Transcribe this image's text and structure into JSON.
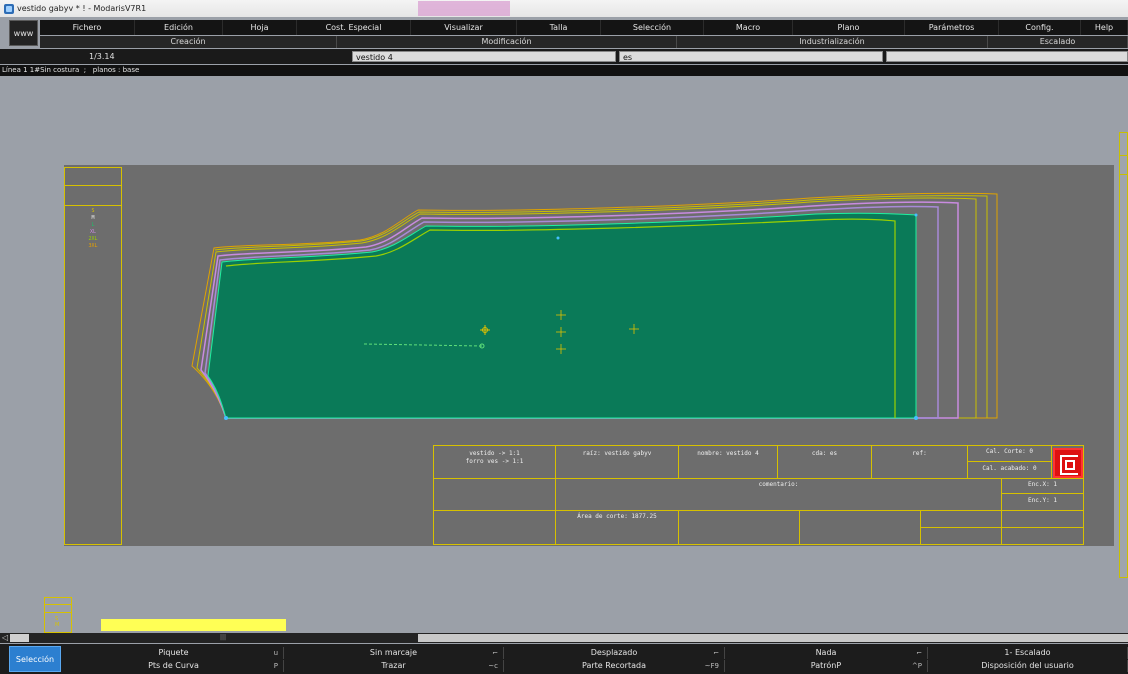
{
  "window": {
    "title": "vestido gabyv * ! - ModarisV7R1"
  },
  "www_button": "www",
  "menu": [
    {
      "label": "Fichero",
      "w": 95
    },
    {
      "label": "Edición",
      "w": 88
    },
    {
      "label": "Hoja",
      "w": 74
    },
    {
      "label": "Cost. Especial",
      "w": 114
    },
    {
      "label": "Visualizar",
      "w": 106
    },
    {
      "label": "Talla",
      "w": 84
    },
    {
      "label": "Selección",
      "w": 103
    },
    {
      "label": "Macro",
      "w": 89
    },
    {
      "label": "Plano",
      "w": 112
    },
    {
      "label": "Parámetros",
      "w": 94
    },
    {
      "label": "Config.",
      "w": 82
    },
    {
      "label": "Help",
      "w": 47
    }
  ],
  "groups": [
    {
      "label": "Creación",
      "w": 297
    },
    {
      "label": "Modificación",
      "w": 340
    },
    {
      "label": "Industrialización",
      "w": 311
    },
    {
      "label": "Escalado",
      "w": 140
    }
  ],
  "fields": {
    "scale": "1/3.14",
    "piece_name": "vestido 4",
    "cda": "es",
    "extra": ""
  },
  "status_line": "Línea 1 1#Sin costura  ;   planos : base",
  "sizes": [
    {
      "label": "S",
      "color": "#d6c100"
    },
    {
      "label": "M",
      "color": "#e8e8e8"
    },
    {
      "label": "L",
      "color": "#1fbf6a"
    },
    {
      "label": "XL",
      "color": "#c98be0"
    },
    {
      "label": "2XL",
      "color": "#9bd100"
    },
    {
      "label": "3XL",
      "color": "#e6a100"
    }
  ],
  "mini_sizes": [
    "S",
    "M"
  ],
  "info_table": {
    "link": "vestido -> 1:1",
    "lining": "forro ves -> 1:1",
    "raiz": "raíz: vestido gabyv",
    "nombre": "nombre: vestido 4",
    "cda": "cda: es",
    "ref": "ref:",
    "cal_corte": "Cal. Corte: 0",
    "cal_acabado": "Cal. acabado: 0",
    "comentario": "comentario:",
    "enc_x": "Enc.X: 1",
    "enc_y": "Enc.Y: 1",
    "area": "Área de corte: 1877.25"
  },
  "colors": {
    "piece_fill": "#0a7a58",
    "piece_edge": "#9bd100",
    "grade_purple": "#a88ad8",
    "grade_orange": "#e0a300",
    "grade_yellow": "#c9c000",
    "accent_blue": "#2c7fd0"
  },
  "bottom": {
    "active_mode": "Selección",
    "row1": [
      {
        "label": "Piquete",
        "key": "u"
      },
      {
        "label": "Sin marcaje",
        "key": "⌐"
      },
      {
        "label": "Desplazado",
        "key": "⌐"
      },
      {
        "label": "Nada",
        "key": "⌐"
      },
      {
        "label": "1- Escalado",
        "key": ""
      }
    ],
    "row2": [
      {
        "label": "Pts de Curva",
        "key": "P"
      },
      {
        "label": "Trazar",
        "key": "~c"
      },
      {
        "label": "Parte Recortada",
        "key": "~F9"
      },
      {
        "label": "PatrónP",
        "key": "^P"
      },
      {
        "label": "Disposición del usuario",
        "key": ""
      }
    ]
  }
}
